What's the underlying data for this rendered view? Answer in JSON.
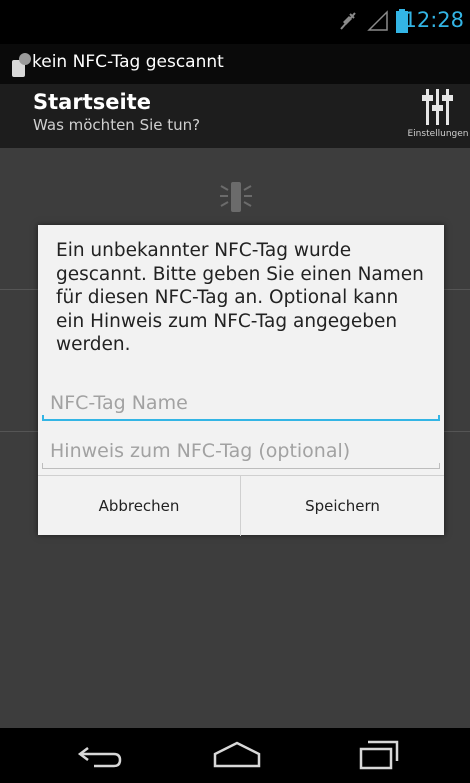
{
  "status_bar": {
    "time": "12:28"
  },
  "notification": {
    "text": "kein NFC-Tag gescannt"
  },
  "action_bar": {
    "title": "Startseite",
    "subtitle": "Was möchten Sie tun?",
    "settings_label": "Einstellungen"
  },
  "dialog": {
    "message": "Ein unbekannter NFC-Tag wurde gescannt. Bitte geben Sie einen Namen für diesen NFC-Tag an. Optional kann ein Hinweis zum NFC-Tag angegeben werden.",
    "name_field": {
      "placeholder": "NFC-Tag Name",
      "value": ""
    },
    "hint_field": {
      "placeholder": "Hinweis zum NFC-Tag (optional)",
      "value": ""
    },
    "cancel_label": "Abbrechen",
    "save_label": "Speichern"
  },
  "colors": {
    "accent": "#33b5e5",
    "action_bar": "#1d1d1d",
    "dialog_bg": "#f2f2f2"
  },
  "icons": {
    "status": [
      "mute-icon",
      "signal-icon",
      "battery-icon"
    ],
    "notification": "nfc-tag-icon",
    "settings": "sliders-icon",
    "content": "nfc-icon",
    "nav": [
      "back-icon",
      "home-icon",
      "recent-apps-icon"
    ]
  }
}
